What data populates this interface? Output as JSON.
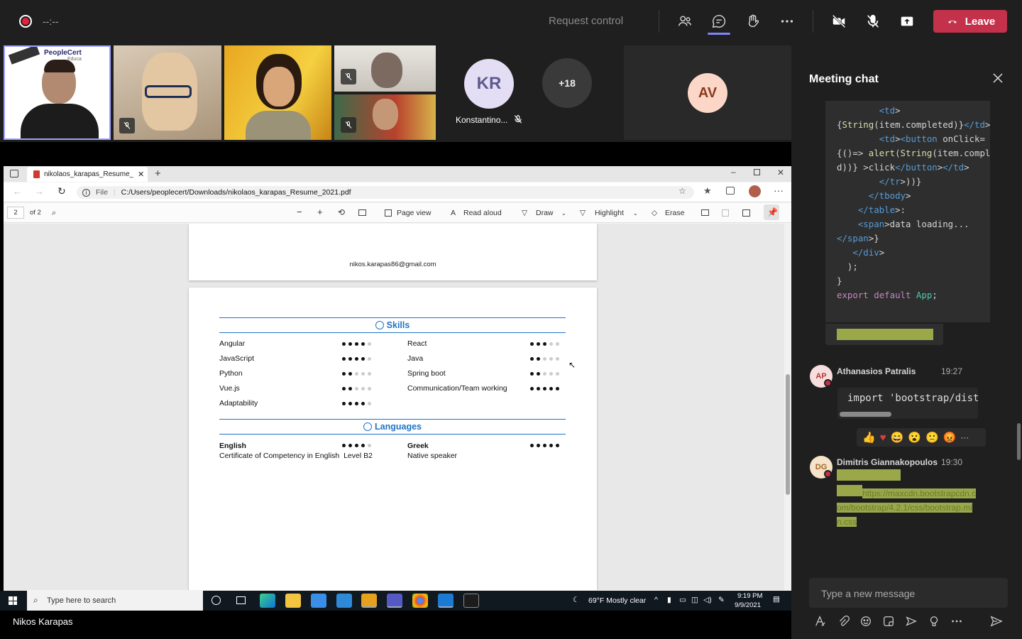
{
  "meeting": {
    "timer": "--:--",
    "request_control": "Request control",
    "leave_label": "Leave"
  },
  "participants": {
    "kr_initials": "KR",
    "kr_name": "Konstantino...",
    "more_count": "+18",
    "av_initials": "AV",
    "logo_text": "PeopleCert",
    "logo_sub": "Educa"
  },
  "browser": {
    "tab_title": "nikolaos_karapas_Resume_2021.pdf",
    "file_label": "File",
    "url": "C:/Users/peoplecert/Downloads/nikolaos_karapas_Resume_2021.pdf",
    "page_num": "2",
    "page_total": "of 2",
    "page_view": "Page view",
    "read_aloud": "Read aloud",
    "draw": "Draw",
    "highlight": "Highlight",
    "erase": "Erase"
  },
  "resume": {
    "email": "nikos.karapas86@gmail.com",
    "skills_title": "Skills",
    "skills": [
      {
        "name": "Angular",
        "level": 4
      },
      {
        "name": "React",
        "level": 3
      },
      {
        "name": "JavaScript",
        "level": 4
      },
      {
        "name": "Java",
        "level": 2
      },
      {
        "name": "Python",
        "level": 2
      },
      {
        "name": "Spring boot",
        "level": 2
      },
      {
        "name": "Vue.js",
        "level": 2
      },
      {
        "name": "Communication/Team working",
        "level": 5
      },
      {
        "name": "Adaptability",
        "level": 4
      }
    ],
    "languages_title": "Languages",
    "languages": [
      {
        "name": "English",
        "level": 4,
        "note": "Certificate of Competency in English  Level B2"
      },
      {
        "name": "Greek",
        "level": 5,
        "note": "Native speaker"
      }
    ]
  },
  "taskbar": {
    "search_placeholder": "Type here to search",
    "weather": "69°F  Mostly clear",
    "time": "9:19 PM",
    "date": "9/9/2021"
  },
  "presenter_name": "Nikos Karapas",
  "chat": {
    "title": "Meeting chat",
    "code_lines": [
      "        <td>",
      "{String(item.completed)}</td>",
      "        <td><button onClick=",
      "{()=> alert(String(item.complete",
      "d))} >click</button></td>",
      "        </tr>))}",
      "      </tbody>",
      "    </table>:",
      "    <span>data loading...",
      "</span>}",
      "   </div>",
      "  );",
      "}",
      "",
      "export default App;"
    ],
    "messages": [
      {
        "initials": "AP",
        "author": "Athanasios Patralis",
        "time": "19:27",
        "code": "import 'bootstrap/dist"
      },
      {
        "initials": "DG",
        "author": "Dimitris Giannakopoulos",
        "time": "19:30",
        "link": "https://maxcdn.bootstrapcdn.com/bootstrap/4.2.1/css/bootstrap.min.css"
      }
    ],
    "input_placeholder": "Type a new message"
  },
  "colors": {
    "leave": "#c4314b",
    "accent": "#7f85f5",
    "resume_blue": "#1e74c8"
  }
}
